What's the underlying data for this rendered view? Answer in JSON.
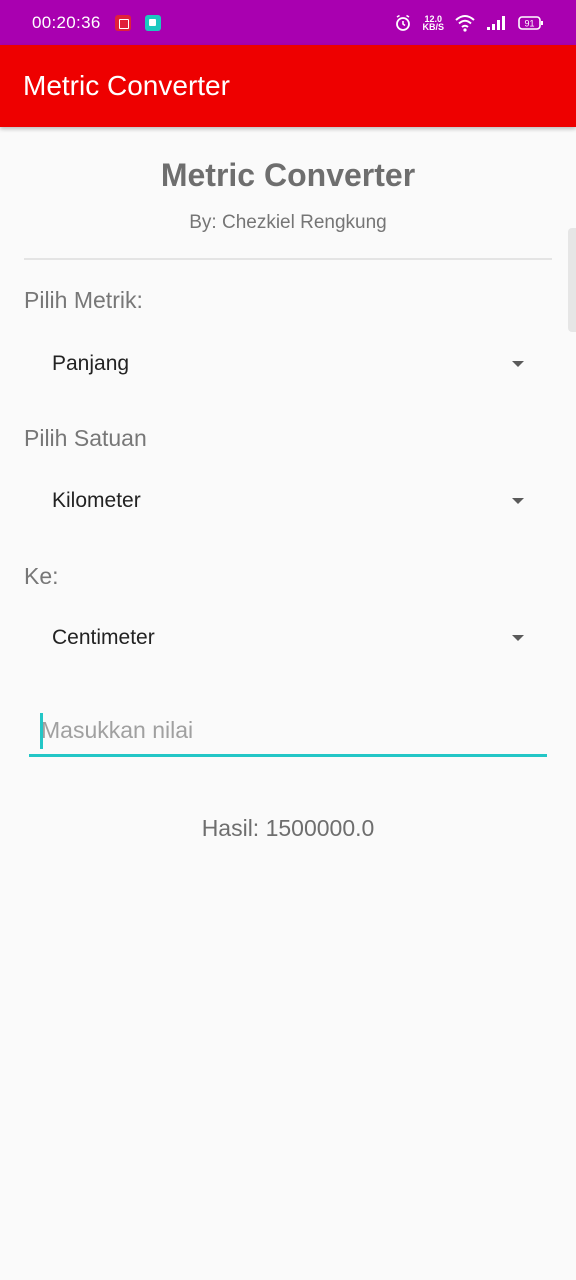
{
  "status_bar": {
    "time": "00:20:36",
    "net_speed_value": "12.0",
    "net_speed_unit": "KB/S",
    "battery": "91",
    "background": "#a900b0"
  },
  "app_bar": {
    "title": "Metric Converter",
    "background": "#ee0000"
  },
  "header": {
    "title": "Metric Converter",
    "subtitle": "By: Chezkiel Rengkung"
  },
  "form": {
    "metric_label": "Pilih Metrik:",
    "metric_value": "Panjang",
    "unit_label": "Pilih Satuan",
    "unit_value": "Kilometer",
    "to_label": "Ke:",
    "to_value": "Centimeter",
    "input_placeholder": "Masukkan nilai",
    "input_value": "",
    "accent": "#23c6c6"
  },
  "result": {
    "text": "Hasil: 1500000.0"
  }
}
